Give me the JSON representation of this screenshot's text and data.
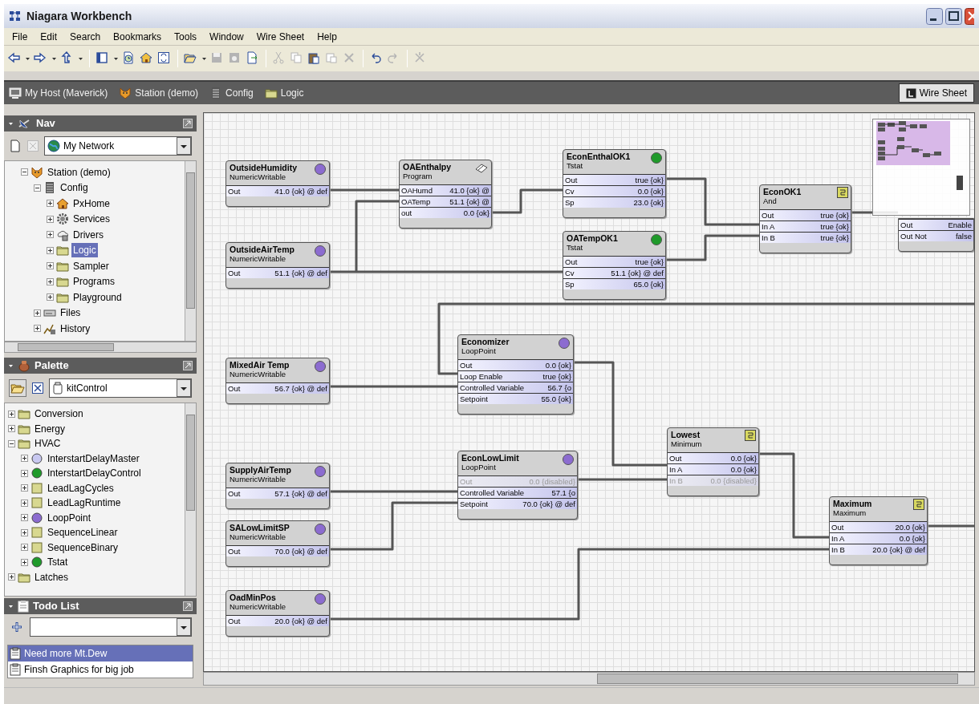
{
  "window": {
    "title": "Niagara Workbench"
  },
  "menu": [
    "File",
    "Edit",
    "Search",
    "Bookmarks",
    "Tools",
    "Window",
    "Wire Sheet",
    "Help"
  ],
  "toolbar": [
    {
      "kind": "back",
      "dropdown": true,
      "disabled": false
    },
    {
      "kind": "forward",
      "dropdown": true,
      "disabled": false
    },
    {
      "kind": "up",
      "dropdown": true,
      "disabled": false
    },
    {
      "kind": "separator"
    },
    {
      "kind": "sidebar",
      "dropdown": true,
      "disabled": false
    },
    {
      "kind": "clockdoc",
      "dropdown": false,
      "disabled": false
    },
    {
      "kind": "home",
      "dropdown": false,
      "disabled": false
    },
    {
      "kind": "refresh",
      "dropdown": false,
      "disabled": false
    },
    {
      "kind": "separator"
    },
    {
      "kind": "open",
      "dropdown": true,
      "disabled": false
    },
    {
      "kind": "save",
      "dropdown": false,
      "disabled": true
    },
    {
      "kind": "saveall",
      "dropdown": false,
      "disabled": true
    },
    {
      "kind": "export",
      "dropdown": false,
      "disabled": false
    },
    {
      "kind": "separator"
    },
    {
      "kind": "cut",
      "dropdown": false,
      "disabled": true
    },
    {
      "kind": "copy",
      "dropdown": false,
      "disabled": true
    },
    {
      "kind": "paste",
      "dropdown": false,
      "disabled": false
    },
    {
      "kind": "duplicate",
      "dropdown": false,
      "disabled": true
    },
    {
      "kind": "delete",
      "dropdown": false,
      "disabled": true
    },
    {
      "kind": "separator"
    },
    {
      "kind": "undo",
      "dropdown": false,
      "disabled": false
    },
    {
      "kind": "redo",
      "dropdown": false,
      "disabled": true
    },
    {
      "kind": "separator"
    },
    {
      "kind": "tools",
      "dropdown": false,
      "disabled": true
    }
  ],
  "path": [
    {
      "label": "My Host (Maverick)",
      "kind": "host"
    },
    {
      "label": "Station (demo)",
      "kind": "station"
    },
    {
      "label": "Config",
      "kind": "config"
    },
    {
      "label": "Logic",
      "kind": "folder"
    }
  ],
  "view": {
    "label": "Wire Sheet"
  },
  "nav": {
    "title": "Nav",
    "dropdown": "My Network",
    "tree": [
      {
        "label": "Station (demo)",
        "kind": "station",
        "expanded": true,
        "selected": false,
        "children": [
          {
            "label": "Config",
            "kind": "config",
            "expanded": true,
            "selected": false,
            "children": [
              {
                "label": "PxHome",
                "kind": "home",
                "expanded": false,
                "selected": false
              },
              {
                "label": "Services",
                "kind": "gear",
                "expanded": false,
                "selected": false
              },
              {
                "label": "Drivers",
                "kind": "drivers",
                "expanded": false,
                "selected": false
              },
              {
                "label": "Logic",
                "kind": "folder",
                "expanded": false,
                "selected": true
              },
              {
                "label": "Sampler",
                "kind": "folder",
                "expanded": false,
                "selected": false
              },
              {
                "label": "Programs",
                "kind": "folder",
                "expanded": false,
                "selected": false
              },
              {
                "label": "Playground",
                "kind": "folder",
                "expanded": false,
                "selected": false
              }
            ]
          },
          {
            "label": "Files",
            "kind": "files",
            "expanded": false,
            "selected": false
          },
          {
            "label": "History",
            "kind": "history",
            "expanded": false,
            "selected": false
          }
        ]
      }
    ]
  },
  "palette": {
    "title": "Palette",
    "dropdown": "kitControl",
    "tree": [
      {
        "label": "Conversion",
        "kind": "folder",
        "expanded": false,
        "selected": false
      },
      {
        "label": "Energy",
        "kind": "folder",
        "expanded": false,
        "selected": false
      },
      {
        "label": "HVAC",
        "kind": "folder",
        "expanded": true,
        "selected": false,
        "children": [
          {
            "label": "InterstartDelayMaster",
            "kind": "circle",
            "color": "#c8c8f0",
            "expanded": false,
            "selected": false
          },
          {
            "label": "InterstartDelayControl",
            "kind": "circle",
            "color": "#1f9a2a",
            "expanded": false,
            "selected": false
          },
          {
            "label": "LeadLagCycles",
            "kind": "block",
            "expanded": false,
            "selected": false
          },
          {
            "label": "LeadLagRuntime",
            "kind": "block",
            "expanded": false,
            "selected": false
          },
          {
            "label": "LoopPoint",
            "kind": "circle",
            "color": "#8c6cd0",
            "expanded": false,
            "selected": false
          },
          {
            "label": "SequenceLinear",
            "kind": "block",
            "expanded": false,
            "selected": false
          },
          {
            "label": "SequenceBinary",
            "kind": "block",
            "expanded": false,
            "selected": false
          },
          {
            "label": "Tstat",
            "kind": "circle",
            "color": "#1f9a2a",
            "expanded": false,
            "selected": false
          }
        ]
      },
      {
        "label": "Latches",
        "kind": "folder",
        "expanded": false,
        "selected": false
      }
    ]
  },
  "todo": {
    "title": "Todo List",
    "items": [
      {
        "label": "Need more Mt.Dew",
        "selected": true
      },
      {
        "label": "Finsh Graphics for big job",
        "selected": false
      }
    ]
  },
  "wiresheet": {
    "nodes": [
      {
        "title": "OutsideHumidity",
        "type": "NumericWritable",
        "icon": {
          "kind": "circle",
          "color": "#8c6cd0"
        },
        "slots": [
          {
            "name": "Out",
            "value": "41.0 {ok} @ def",
            "disabled": false
          }
        ]
      },
      {
        "title": "OAEnthalpy",
        "type": "Program",
        "icon": {
          "kind": "program"
        },
        "slots": [
          {
            "name": "OAHumd",
            "value": "41.0 {ok} @",
            "disabled": false
          },
          {
            "name": "OATemp",
            "value": "51.1 {ok} @",
            "disabled": false
          },
          {
            "name": "out",
            "value": "0.0 {ok}",
            "disabled": false
          }
        ]
      },
      {
        "title": "EconEnthalOK1",
        "type": "Tstat",
        "icon": {
          "kind": "circle",
          "color": "#1f9a2a"
        },
        "slots": [
          {
            "name": "Out",
            "value": "true {ok}",
            "disabled": false
          },
          {
            "name": "Cv",
            "value": "0.0 {ok}",
            "disabled": false
          },
          {
            "name": "Sp",
            "value": "23.0 {ok}",
            "disabled": false
          }
        ]
      },
      {
        "title": "OutsideAirTemp",
        "type": "NumericWritable",
        "icon": {
          "kind": "circle",
          "color": "#8c6cd0"
        },
        "slots": [
          {
            "name": "Out",
            "value": "51.1 {ok} @ def",
            "disabled": false
          }
        ]
      },
      {
        "title": "OATempOK1",
        "type": "Tstat",
        "icon": {
          "kind": "circle",
          "color": "#1f9a2a"
        },
        "slots": [
          {
            "name": "Out",
            "value": "true {ok}",
            "disabled": false
          },
          {
            "name": "Cv",
            "value": "51.1 {ok} @ def",
            "disabled": false
          },
          {
            "name": "Sp",
            "value": "65.0 {ok}",
            "disabled": false
          }
        ]
      },
      {
        "title": "EconOK1",
        "type": "And",
        "icon": {
          "kind": "block"
        },
        "slots": [
          {
            "name": "Out",
            "value": "true {ok}",
            "disabled": false
          },
          {
            "name": "In A",
            "value": "true {ok}",
            "disabled": false
          },
          {
            "name": "In B",
            "value": "true {ok}",
            "disabled": false
          }
        ]
      },
      {
        "slots": [
          {
            "name": "Out",
            "value": "Enable",
            "disabled": false
          },
          {
            "name": "Out Not",
            "value": "false",
            "disabled": false
          }
        ]
      },
      {
        "title": "MixedAir Temp",
        "type": "NumericWritable",
        "icon": {
          "kind": "circle",
          "color": "#8c6cd0"
        },
        "slots": [
          {
            "name": "Out",
            "value": "56.7 {ok} @ def",
            "disabled": false
          }
        ]
      },
      {
        "title": "Economizer",
        "type": "LoopPoint",
        "icon": {
          "kind": "circle",
          "color": "#8c6cd0"
        },
        "slots": [
          {
            "name": "Out",
            "value": "0.0 {ok}",
            "disabled": false
          },
          {
            "name": "Loop Enable",
            "value": "true {ok}",
            "disabled": false
          },
          {
            "name": "Controlled Variable",
            "value": "56.7 {o",
            "disabled": false
          },
          {
            "name": "Setpoint",
            "value": "55.0 {ok}",
            "disabled": false
          }
        ]
      },
      {
        "title": "Lowest",
        "type": "Minimum",
        "icon": {
          "kind": "block"
        },
        "slots": [
          {
            "name": "Out",
            "value": "0.0 {ok}",
            "disabled": false
          },
          {
            "name": "In A",
            "value": "0.0 {ok}",
            "disabled": false
          },
          {
            "name": "In B",
            "value": "0.0 {disabled}",
            "disabled": true
          }
        ]
      },
      {
        "title": "SupplyAirTemp",
        "type": "NumericWritable",
        "icon": {
          "kind": "circle",
          "color": "#8c6cd0"
        },
        "slots": [
          {
            "name": "Out",
            "value": "57.1 {ok} @ def",
            "disabled": false
          }
        ]
      },
      {
        "title": "EconLowLimit",
        "type": "LoopPoint",
        "icon": {
          "kind": "circle",
          "color": "#8c6cd0"
        },
        "slots": [
          {
            "name": "Out",
            "value": "0.0 {disabled}",
            "disabled": true
          },
          {
            "name": "Controlled Variable",
            "value": "57.1 {o",
            "disabled": false
          },
          {
            "name": "Setpoint",
            "value": "70.0 {ok} @ def",
            "disabled": false
          }
        ]
      },
      {
        "title": "SALowLimitSP",
        "type": "NumericWritable",
        "icon": {
          "kind": "circle",
          "color": "#8c6cd0"
        },
        "slots": [
          {
            "name": "Out",
            "value": "70.0 {ok} @ def",
            "disabled": false
          }
        ]
      },
      {
        "title": "Maximum",
        "type": "Maximum",
        "icon": {
          "kind": "block"
        },
        "slots": [
          {
            "name": "Out",
            "value": "20.0 {ok}",
            "disabled": false
          },
          {
            "name": "In A",
            "value": "0.0 {ok}",
            "disabled": false
          },
          {
            "name": "In B",
            "value": "20.0 {ok} @ def",
            "disabled": false
          }
        ]
      },
      {
        "title": "OadMinPos",
        "type": "NumericWritable",
        "icon": {
          "kind": "circle",
          "color": "#8c6cd0"
        },
        "slots": [
          {
            "name": "Out",
            "value": "20.0 {ok} @ def",
            "disabled": false
          }
        ]
      }
    ]
  }
}
